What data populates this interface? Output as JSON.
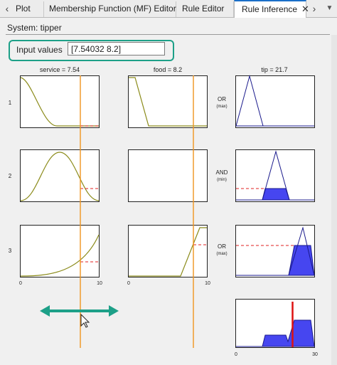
{
  "tabs": [
    {
      "label": "Plot"
    },
    {
      "label": "Membership Function (MF) Editor"
    },
    {
      "label": "Rule Editor"
    },
    {
      "label": "Rule Inference",
      "close": "✕",
      "active": true
    }
  ],
  "system": {
    "label": "System: tipper"
  },
  "input": {
    "label": "Input values",
    "value": "[7.54032 8.2]"
  },
  "columns": {
    "service": "service = 7.54",
    "food": "food = 8.2",
    "tip": "tip = 21.7"
  },
  "rules": [
    {
      "number": "1",
      "op": "OR",
      "method": "(max)"
    },
    {
      "number": "2",
      "op": "AND",
      "method": "(min)"
    },
    {
      "number": "3",
      "op": "OR",
      "method": "(max)"
    }
  ],
  "axes": {
    "input_min": "0",
    "input_max": "10",
    "output_min": "0",
    "output_max": "30"
  },
  "icons": {
    "scroll_left": "chevron-left-icon",
    "scroll_right": "chevron-right-icon",
    "dropdown": "chevron-down-icon",
    "drag_arrow": "double-arrow-icon",
    "cursor": "mouse-pointer-icon"
  },
  "colors": {
    "mf_curve": "#8b8b1a",
    "output_mf": "#1a1a8c",
    "fill": "#4646f0",
    "cursor_line": "#f0941e",
    "dashed": "#e02020",
    "result_line": "#dd1111",
    "highlight": "#1da088",
    "tab_accent": "#1a6fc8"
  },
  "values": {
    "service": 7.54,
    "food": 8.2,
    "tip": 21.7
  }
}
